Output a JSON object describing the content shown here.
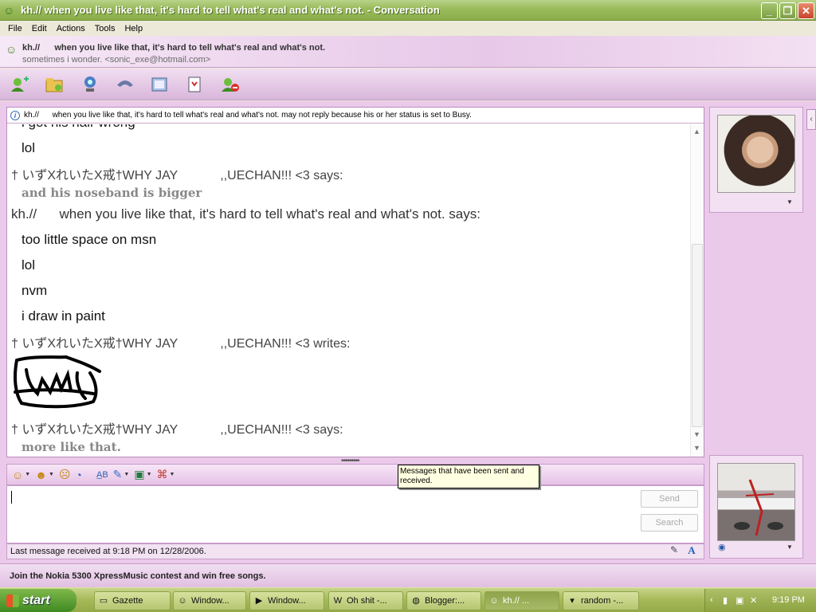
{
  "window": {
    "title": "kh.//      when you live like that, it's hard to tell what's real and what's not. - Conversation",
    "min_glyph": "_",
    "max_glyph": "❐",
    "close_glyph": "✕"
  },
  "menu": [
    "File",
    "Edit",
    "Actions",
    "Tools",
    "Help"
  ],
  "header": {
    "contact_name": "kh.//      when you live like that, it's hard to tell what's real and what's not.",
    "personal_message": "sometimes i wonder. <sonic_exe@hotmail.com>"
  },
  "toolbar": {
    "icons": [
      "invite-contact-icon",
      "send-files-icon",
      "video-call-icon",
      "voice-call-icon",
      "activities-icon",
      "games-icon",
      "block-icon"
    ]
  },
  "info_bar": {
    "text": "kh.//      when you live like that, it's hard to tell what's real and what's not. may not reply because his or her status is set to Busy."
  },
  "transcript": {
    "line_partial": "i got his hair wrong",
    "line_lol1": "lol",
    "sender_a1": "† いずXれいたX戒†WHY JAY            ,,UECHAN!!! <3 says:",
    "msg_noseband": "and his noseband is bigger",
    "sender_b": "kh.//      when you live like that, it's hard to tell what's real and what's not. says:",
    "line_space": "too little space on msn",
    "line_lol2": "lol",
    "line_nvm": "nvm",
    "line_paint": "i draw in paint",
    "sender_a2": "† いずXれいたX戒†WHY JAY            ,,UECHAN!!! <3 writes:",
    "sender_a3": "† いずXれいたX戒†WHY JAY            ,,UECHAN!!! <3 says:",
    "msg_more": "more like that."
  },
  "tooltip": {
    "text": "Messages that have been sent and received."
  },
  "compose": {
    "send_label": "Send",
    "search_label": "Search",
    "status_text": "Last message received at 9:18 PM on 12/28/2006."
  },
  "ad": {
    "text": "Join the Nokia 5300 XpressMusic contest and win free songs."
  },
  "taskbar": {
    "start_label": "start",
    "tasks": [
      "Gazette",
      "Window...",
      "Window...",
      "Oh shit -...",
      "Blogger:...",
      "kh.//    ...",
      "random -..."
    ],
    "clock": "9:19 PM"
  },
  "colors": {
    "window_accent": "#9cbc5e",
    "panel_bg": "#ebc9ea",
    "tooltip_bg": "#ffffe1"
  }
}
